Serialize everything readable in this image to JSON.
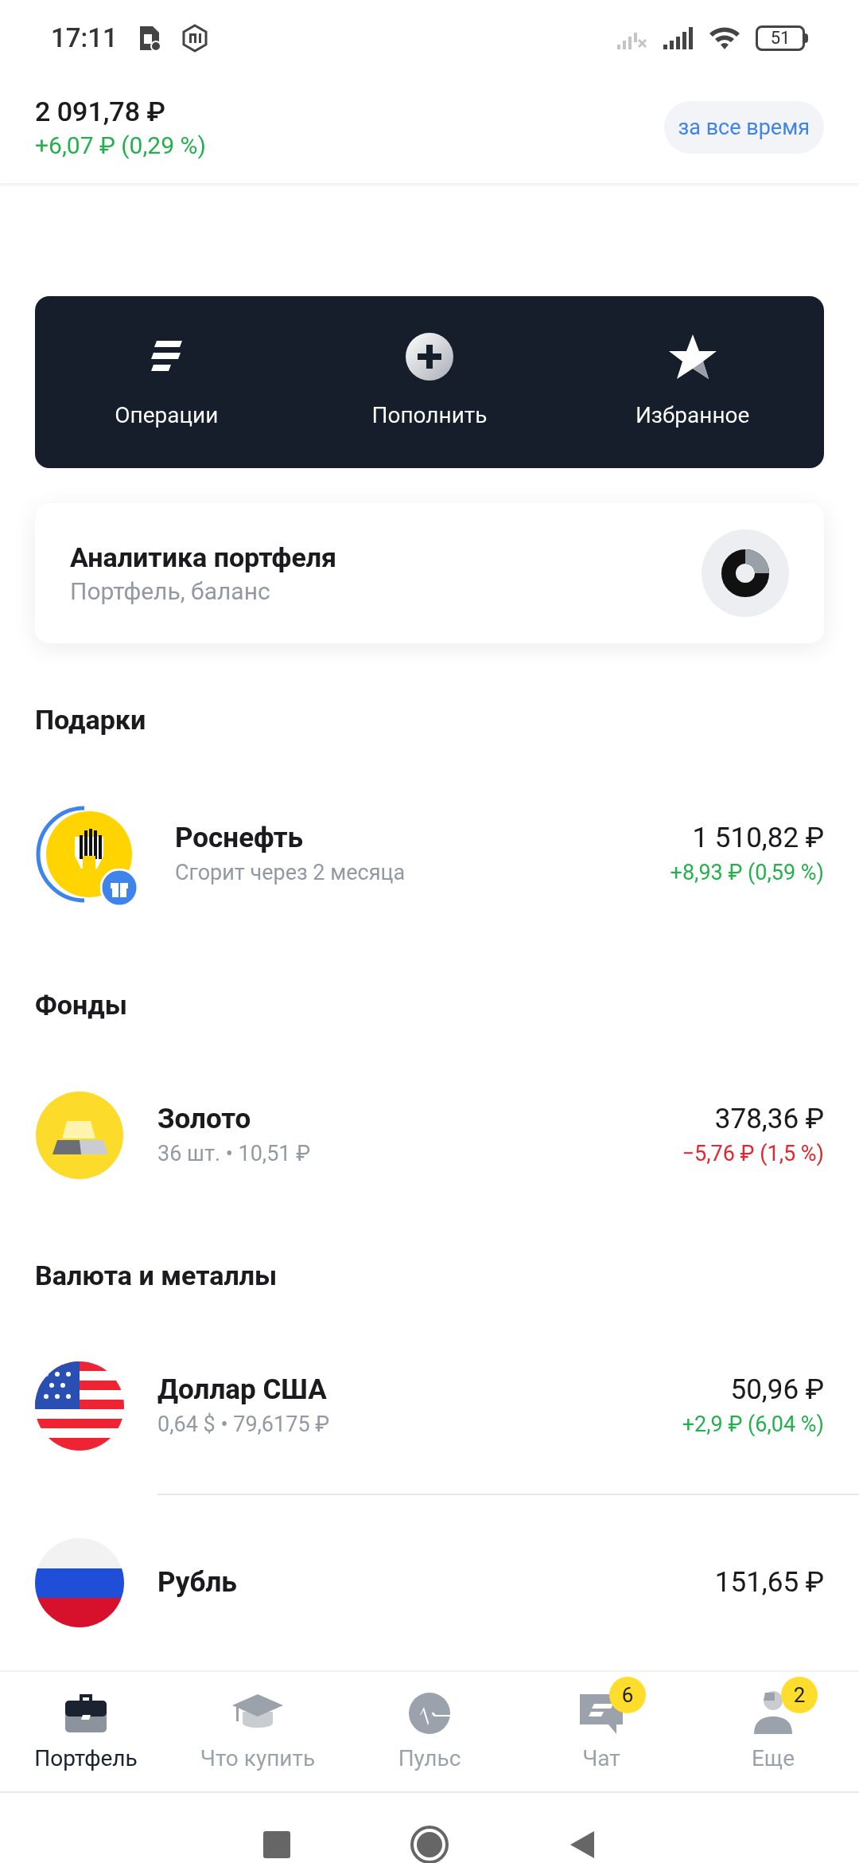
{
  "status_bar": {
    "time": "17:11",
    "battery": "51"
  },
  "header": {
    "balance": "2 091,78 ₽",
    "change": "+6,07 ₽ (0,29 %)",
    "loss": false,
    "period_button": "за все время"
  },
  "actions": [
    {
      "kind": "operations",
      "label": "Операции"
    },
    {
      "kind": "topup",
      "label": "Пополнить"
    },
    {
      "kind": "favorites",
      "label": "Избранное"
    }
  ],
  "analytics": {
    "title": "Аналитика портфеля",
    "subtitle": "Портфель, баланс"
  },
  "sections": [
    {
      "title": "Подарки",
      "items": [
        {
          "kind": "oil",
          "gift": true,
          "name": "Роснефть",
          "subtitle": "Сгорит через 2 месяца",
          "value": "1 510,82 ₽",
          "change": "+8,93 ₽ (0,59 %)",
          "loss": false,
          "divider": false
        }
      ]
    },
    {
      "title": "Фонды",
      "items": [
        {
          "kind": "gold",
          "gift": false,
          "name": "Золото",
          "subtitle": "36 шт. • 10,51 ₽",
          "value": "378,36 ₽",
          "change": "−5,76 ₽ (1,5 %)",
          "loss": true,
          "divider": false
        }
      ]
    },
    {
      "title": "Валюта и металлы",
      "items": [
        {
          "kind": "usd",
          "gift": false,
          "name": "Доллар США",
          "subtitle": "0,64 $ • 79,6175 ₽",
          "value": "50,96 ₽",
          "change": "+2,9 ₽ (6,04 %)",
          "loss": false,
          "divider": true
        },
        {
          "kind": "rub",
          "gift": false,
          "name": "Рубль",
          "value": "151,65 ₽",
          "divider": false
        }
      ]
    }
  ],
  "bottom_nav": [
    {
      "kind": "briefcase",
      "label": "Портфель",
      "selected": true
    },
    {
      "kind": "cap",
      "label": "Что купить",
      "selected": false
    },
    {
      "kind": "pulse",
      "label": "Пульс",
      "selected": false
    },
    {
      "kind": "chat",
      "label": "Чат",
      "selected": false,
      "badge": "6"
    },
    {
      "kind": "person",
      "label": "Еще",
      "selected": false,
      "badge": "2"
    }
  ]
}
